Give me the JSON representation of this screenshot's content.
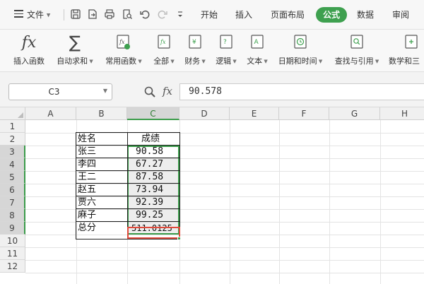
{
  "menubar": {
    "file_label": "文件",
    "tabs": [
      {
        "label": "开始"
      },
      {
        "label": "插入"
      },
      {
        "label": "页面布局"
      },
      {
        "label": "公式"
      },
      {
        "label": "数据"
      },
      {
        "label": "审阅"
      }
    ],
    "active_tab": "公式",
    "accent_color": "#3ea04f"
  },
  "ribbon": {
    "items": [
      {
        "label": "插入函数",
        "icon": "fx-icon"
      },
      {
        "label": "自动求和",
        "icon": "sigma-icon"
      },
      {
        "label": "常用函数",
        "icon": "common-fx-icon"
      },
      {
        "label": "全部",
        "icon": "all-fx-icon"
      },
      {
        "label": "财务",
        "icon": "finance-icon"
      },
      {
        "label": "逻辑",
        "icon": "logic-icon"
      },
      {
        "label": "文本",
        "icon": "text-icon"
      },
      {
        "label": "日期和时间",
        "icon": "clock-icon"
      },
      {
        "label": "查找与引用",
        "icon": "lookup-icon"
      },
      {
        "label": "数学和三",
        "icon": "math-icon"
      }
    ]
  },
  "formula_bar": {
    "name_box": "C3",
    "fx_label": "fx",
    "formula": "90.578"
  },
  "grid": {
    "columns": [
      "A",
      "B",
      "C",
      "D",
      "E",
      "F",
      "G",
      "H"
    ],
    "rows": [
      "1",
      "2",
      "3",
      "4",
      "5",
      "6",
      "7",
      "8",
      "9",
      "10",
      "11",
      "12"
    ],
    "header": {
      "name": "姓名",
      "score": "成绩"
    },
    "data": [
      {
        "name": "张三",
        "score": "90.58"
      },
      {
        "name": "李四",
        "score": "67.27"
      },
      {
        "name": "王二",
        "score": "87.58"
      },
      {
        "name": "赵五",
        "score": "73.94"
      },
      {
        "name": "贾六",
        "score": "92.39"
      },
      {
        "name": "麻子",
        "score": "99.25"
      },
      {
        "name": "总分",
        "score": "511.0125"
      }
    ]
  }
}
